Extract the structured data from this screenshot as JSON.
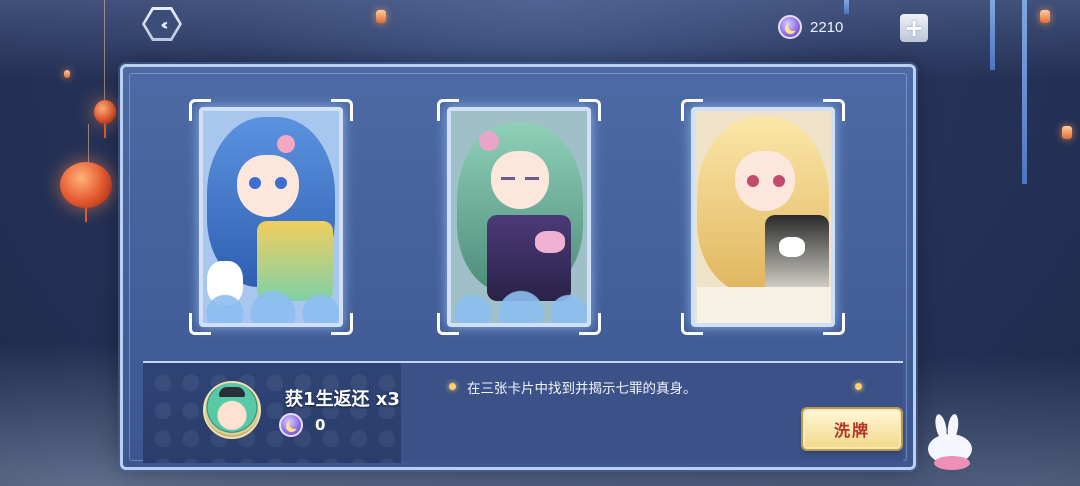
{
  "topbar": {
    "back_icon": "double-chevron-left-icon",
    "back_glyph": "‹‹",
    "currency_icon": "moon-coin-icon",
    "currency_value": "2210",
    "plus_glyph": "+"
  },
  "cards": [
    {
      "name": "blue-haired-girl-card",
      "hair": "#4f86d8",
      "hair_dark": "#2f5fb0",
      "eye": "#3d6fd1",
      "bg": "#a9c7ee"
    },
    {
      "name": "green-haired-girl-card",
      "hair": "#78b8a3",
      "hair_dark": "#4e8c7a",
      "eye": "#6b5a8c",
      "bg": "#9ec0c6"
    },
    {
      "name": "blonde-girl-card",
      "hair": "#f4d88a",
      "hair_dark": "#d9b25a",
      "eye": "#c24a6a",
      "bg": "#f0e2c8"
    }
  ],
  "reward": {
    "title": "获1生返还 x3",
    "coin_icon": "moon-coin-icon",
    "count": "0"
  },
  "hint": "在三张卡片中找到并揭示七罪的真身。",
  "shuffle_label": "洗牌",
  "colors": {
    "panel": "#4d6aa5",
    "accent_gold": "#f3d98c",
    "button_text": "#b3322a"
  }
}
